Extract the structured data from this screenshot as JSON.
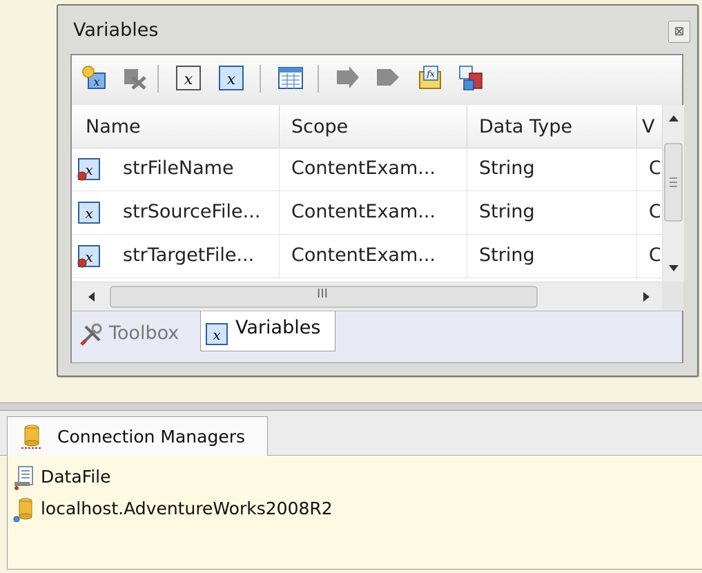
{
  "variables_window": {
    "title": "Variables",
    "close_glyph": "⊠",
    "toolbar": [
      {
        "name": "add-variable-icon",
        "enabled": true
      },
      {
        "name": "delete-variable-icon",
        "enabled": false
      },
      {
        "name": "show-system-variables-icon",
        "enabled": true
      },
      {
        "name": "show-all-variables-icon",
        "enabled": true
      },
      {
        "name": "choose-columns-icon",
        "enabled": true
      },
      {
        "name": "move-variable-icon",
        "enabled": false
      },
      {
        "name": "copy-variable-icon",
        "enabled": false
      },
      {
        "name": "edit-expression-icon",
        "enabled": true
      },
      {
        "name": "parameterize-icon",
        "enabled": true
      }
    ],
    "columns": [
      "Name",
      "Scope",
      "Data Type",
      "V"
    ],
    "rows": [
      {
        "icon": "variable-expression-icon",
        "name": "strFileName",
        "scope": "ContentExam...",
        "type": "String",
        "value": "C"
      },
      {
        "icon": "variable-icon",
        "name": "strSourceFile...",
        "scope": "ContentExam...",
        "type": "String",
        "value": "C"
      },
      {
        "icon": "variable-expression-icon",
        "name": "strTargetFile...",
        "scope": "ContentExam...",
        "type": "String",
        "value": "C"
      }
    ],
    "hscroll_grip": "III",
    "tabs": [
      {
        "label": "Toolbox",
        "icon": "toolbox-icon",
        "active": false
      },
      {
        "label": "Variables",
        "icon": "variables-icon",
        "active": true
      }
    ]
  },
  "connection_managers": {
    "tab_label": "Connection Managers",
    "items": [
      {
        "label": "DataFile",
        "icon": "flat-file-connection-icon"
      },
      {
        "label": "localhost.AdventureWorks2008R2",
        "icon": "ole-db-connection-icon"
      }
    ]
  },
  "colors": {
    "background": "#f6f3df",
    "variable_icon_blue": "#4a8fd6",
    "expression_badge_red": "#c0392b"
  }
}
